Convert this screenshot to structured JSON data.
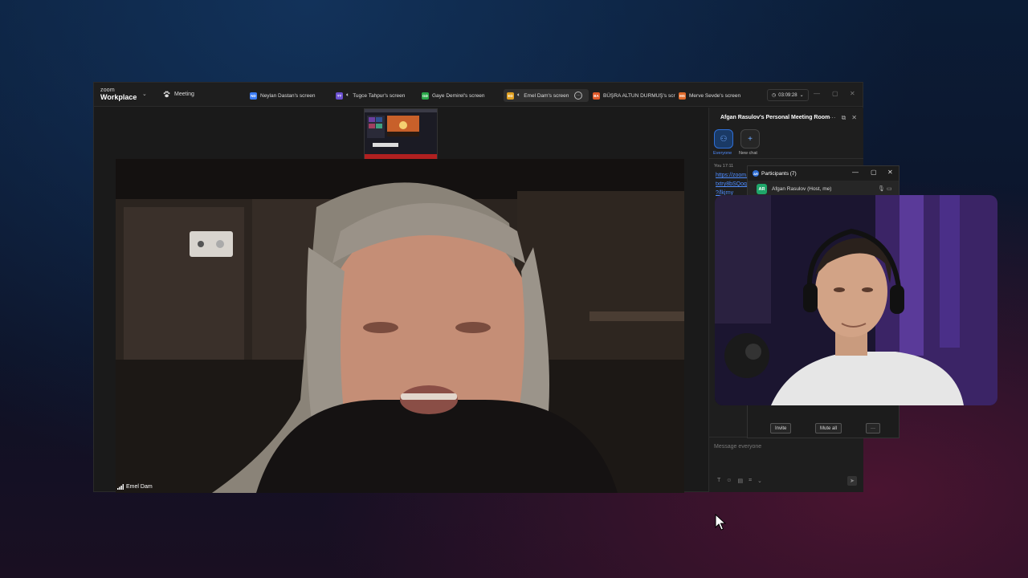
{
  "app": {
    "brand_line1": "zoom",
    "brand_line2": "Workplace"
  },
  "titlebar": {
    "meeting_label": "Meeting",
    "tabs": [
      {
        "initials": "ND",
        "color": "#3b7cf5",
        "label": "Neylan Dastan's screen",
        "active": false
      },
      {
        "initials": "TT",
        "color": "#6a4fd0",
        "label": "Tugce Tahpur's screen",
        "active": false
      },
      {
        "initials": "GD",
        "color": "#2aa84a",
        "label": "Gaye Demirel's screen",
        "active": false
      },
      {
        "initials": "ED",
        "color": "#e0a020",
        "label": "Emel Dam's screen",
        "active": true
      },
      {
        "initials": "BA",
        "color": "#e05a2a",
        "label": "BÜŞRA ALTUN DURMUŞ's scr",
        "active": false
      },
      {
        "initials": "MS",
        "color": "#e06a2a",
        "label": "Merve Sevde's screen",
        "active": false
      }
    ],
    "timer": "03:09:28"
  },
  "video": {
    "speaker_name": "Emel Dam"
  },
  "chat_panel": {
    "title": "Afgan Rasulov's Personal Meeting Room",
    "everyone_label": "Everyone",
    "new_chat_label": "New chat",
    "message_time": "You 17:11",
    "link_lines": [
      "https://zoom.",
      "txtry8bSQoq",
      "?/lkjrny",
      "1"
    ],
    "input_placeholder": "Message everyone"
  },
  "participants_panel": {
    "title": "Participants (7)",
    "title_badge": "AR",
    "row": {
      "initials": "AR",
      "name": "Afgan Rasulov (Host, me)"
    },
    "invite_label": "Invite",
    "mute_all_label": "Mute all",
    "more_label": "···"
  },
  "icons": {
    "paw": "paw-icon",
    "speaker": "speaker-icon",
    "clock": "clock-icon",
    "mic": "mic-icon",
    "camera": "camera-icon",
    "cursor": "cursor-icon"
  }
}
